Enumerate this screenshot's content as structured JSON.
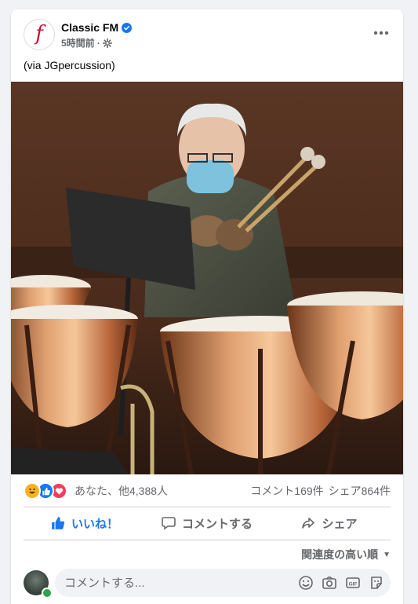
{
  "post": {
    "page_name": "Classic FM",
    "page_logo_letter": "f",
    "time": "5時間前",
    "separator": "·",
    "caption": "(via JGpercussion)"
  },
  "reactions": {
    "summary": "あなた、他4,388人",
    "comments": "コメント169件",
    "shares": "シェア864件"
  },
  "actions": {
    "like": "いいね！",
    "comment": "コメントする",
    "share": "シェア"
  },
  "comments": {
    "sort_label": "関連度の高い順",
    "input_placeholder": "コメントする..."
  },
  "icons": {
    "verified": "verified-badge-icon",
    "audience": "gear-icon",
    "more": "more-horizontal-icon"
  },
  "colors": {
    "accent": "#1877f2",
    "secondary_text": "#65676b",
    "logo_red": "#c8102e"
  }
}
